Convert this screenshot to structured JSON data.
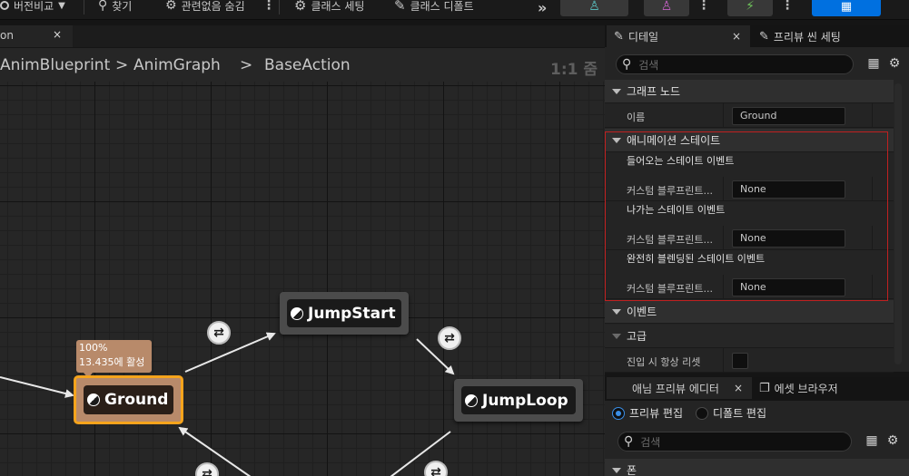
{
  "toolbar": {
    "diff_label": "버전비교",
    "find_label": "찾기",
    "hide_unrelated_label": "관련없음 숨김",
    "class_settings_label": "클래스 세팅",
    "class_defaults_label": "클래스 디폴트"
  },
  "graph_tab": {
    "label": "on",
    "close": "×"
  },
  "breadcrumb": {
    "items": [
      "AnimBlueprint",
      "AnimGraph",
      "BaseAction"
    ],
    "separator": ">",
    "zoom": "1:1 줌"
  },
  "graph": {
    "states": [
      {
        "name": "Ground",
        "selected": true
      },
      {
        "name": "JumpStart",
        "selected": false
      },
      {
        "name": "JumpLoop",
        "selected": false
      }
    ],
    "tooltip": {
      "line1": "100%",
      "line2": "13.435에 활성"
    }
  },
  "details": {
    "tabs": [
      {
        "label": "디테일",
        "close": "×"
      },
      {
        "label": "프리뷰 씬 세팅"
      }
    ],
    "search_placeholder": "검색",
    "categories": {
      "graph_node": {
        "title": "그래프 노드",
        "name_label": "이름",
        "name_value": "Ground"
      },
      "anim_state": {
        "title": "애니메이션 스테이트",
        "entered_title": "들어오는 스테이트 이벤트",
        "left_title": "나가는 스테이트 이벤트",
        "fully_blended_title": "완전히 블렌딩된 스테이트 이벤트",
        "custom_label": "커스텀 블루프린트...",
        "none_value": "None"
      },
      "events": {
        "title": "이벤트"
      },
      "advanced": {
        "title": "고급",
        "always_reset_label": "진입 시 항상 리셋"
      }
    }
  },
  "preview": {
    "tabs": [
      {
        "label": "애님 프리뷰 에디터",
        "close": "×"
      },
      {
        "label": "에셋 브라우저"
      }
    ],
    "edit_preview": "프리뷰 편집",
    "edit_defaults": "디폴트 편집",
    "search_placeholder": "검색",
    "pawn_category": "폰"
  },
  "colors": {
    "selection_border": "#f7a51a",
    "accent_blue": "#0070e0",
    "highlight_red": "#c02020"
  }
}
